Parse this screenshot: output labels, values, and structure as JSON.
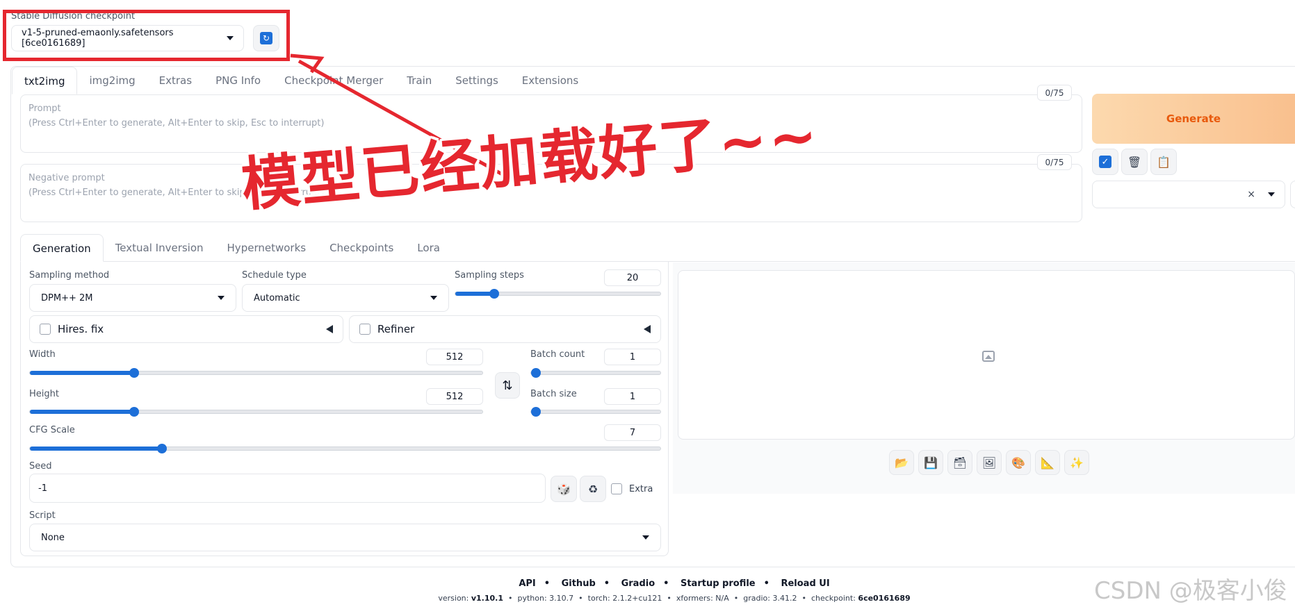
{
  "checkpoint": {
    "label": "Stable Diffusion checkpoint",
    "value": "v1-5-pruned-emaonly.safetensors [6ce0161689]",
    "refresh_icon": "refresh-icon"
  },
  "top_tabs": [
    "txt2img",
    "img2img",
    "Extras",
    "PNG Info",
    "Checkpoint Merger",
    "Train",
    "Settings",
    "Extensions"
  ],
  "prompt": {
    "label": "Prompt",
    "placeholder": "(Press Ctrl+Enter to generate, Alt+Enter to skip, Esc to interrupt)",
    "counter": "0/75"
  },
  "negative_prompt": {
    "label": "Negative prompt",
    "placeholder": "(Press Ctrl+Enter to generate, Alt+Enter to skip, Esc to interrupt)",
    "counter": "0/75"
  },
  "generate": {
    "label": "Generate"
  },
  "styles": {
    "clear_glyph": "×"
  },
  "sub_tabs": [
    "Generation",
    "Textual Inversion",
    "Hypernetworks",
    "Checkpoints",
    "Lora"
  ],
  "sampling": {
    "method_label": "Sampling method",
    "method_value": "DPM++ 2M",
    "schedule_label": "Schedule type",
    "schedule_value": "Automatic",
    "steps_label": "Sampling steps",
    "steps_value": "20",
    "steps_fraction": 0.19
  },
  "hires": {
    "label": "Hires. fix"
  },
  "refiner": {
    "label": "Refiner"
  },
  "width": {
    "label": "Width",
    "value": "512",
    "fraction": 0.23
  },
  "height": {
    "label": "Height",
    "value": "512",
    "fraction": 0.23
  },
  "swap_glyph": "⇅",
  "batch_count": {
    "label": "Batch count",
    "value": "1",
    "fraction": 0.0
  },
  "batch_size": {
    "label": "Batch size",
    "value": "1",
    "fraction": 0.0
  },
  "cfg": {
    "label": "CFG Scale",
    "value": "7",
    "fraction": 0.21
  },
  "seed": {
    "label": "Seed",
    "value": "-1",
    "extra_label": "Extra"
  },
  "script": {
    "label": "Script",
    "value": "None"
  },
  "output_tools": [
    "folder-icon",
    "save-icon",
    "zip-icon",
    "send-to-img2img-icon",
    "send-to-inpaint-icon",
    "send-to-extras-icon",
    "sparkle-icon"
  ],
  "footer": {
    "links": [
      "API",
      "Github",
      "Gradio",
      "Startup profile",
      "Reload UI"
    ],
    "version_label": "version:",
    "version": "v1.10.1",
    "python": "python: 3.10.7",
    "torch": "torch: 2.1.2+cu121",
    "xformers": "xformers: N/A",
    "gradio": "gradio: 3.41.2",
    "checkpoint_label": "checkpoint:",
    "checkpoint": "6ce0161689"
  },
  "annotation": {
    "text": "模型已经加载好了~~"
  },
  "watermark": {
    "text": "CSDN @极客小俊"
  },
  "colors": {
    "accent": "#1d6fd8",
    "generate_text": "#e8590c",
    "annotation": "#e5272f"
  }
}
